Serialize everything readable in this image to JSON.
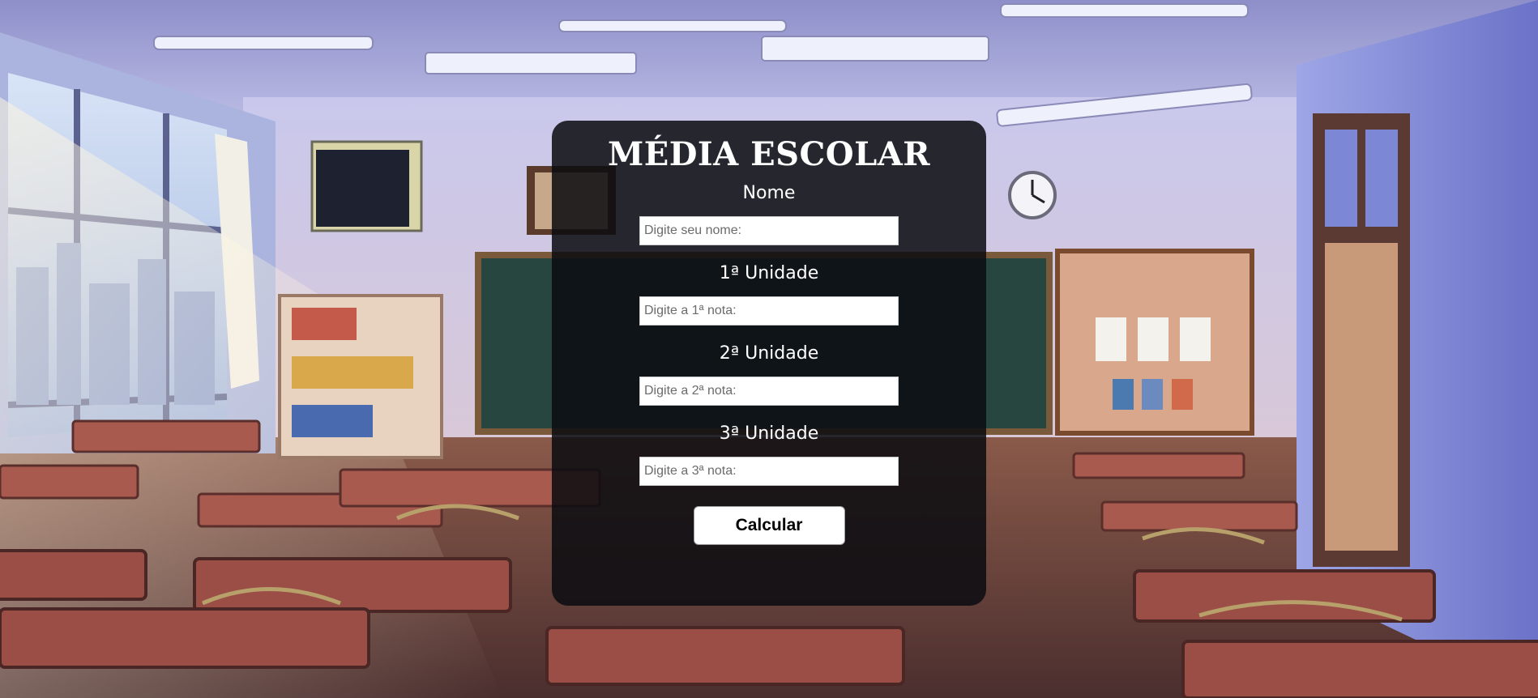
{
  "form": {
    "title": "MÉDIA ESCOLAR",
    "name_label": "Nome",
    "name_placeholder": "Digite seu nome:",
    "name_value": "",
    "unit1_label": "1ª Unidade",
    "unit1_placeholder": "Digite a 1ª nota:",
    "unit1_value": "",
    "unit2_label": "2ª Unidade",
    "unit2_placeholder": "Digite a 2ª nota:",
    "unit2_value": "",
    "unit3_label": "3ª Unidade",
    "unit3_placeholder": "Digite a 3ª nota:",
    "unit3_value": "",
    "calculate_label": "Calcular"
  },
  "background": {
    "description_icon": "classroom-illustration",
    "clock_icon": "wall-clock-icon",
    "tv_icon": "ceiling-tv-icon"
  },
  "colors": {
    "panel": "#0a0c10",
    "text": "#ffffff",
    "button_bg": "#ffffff",
    "button_text": "#000000"
  }
}
